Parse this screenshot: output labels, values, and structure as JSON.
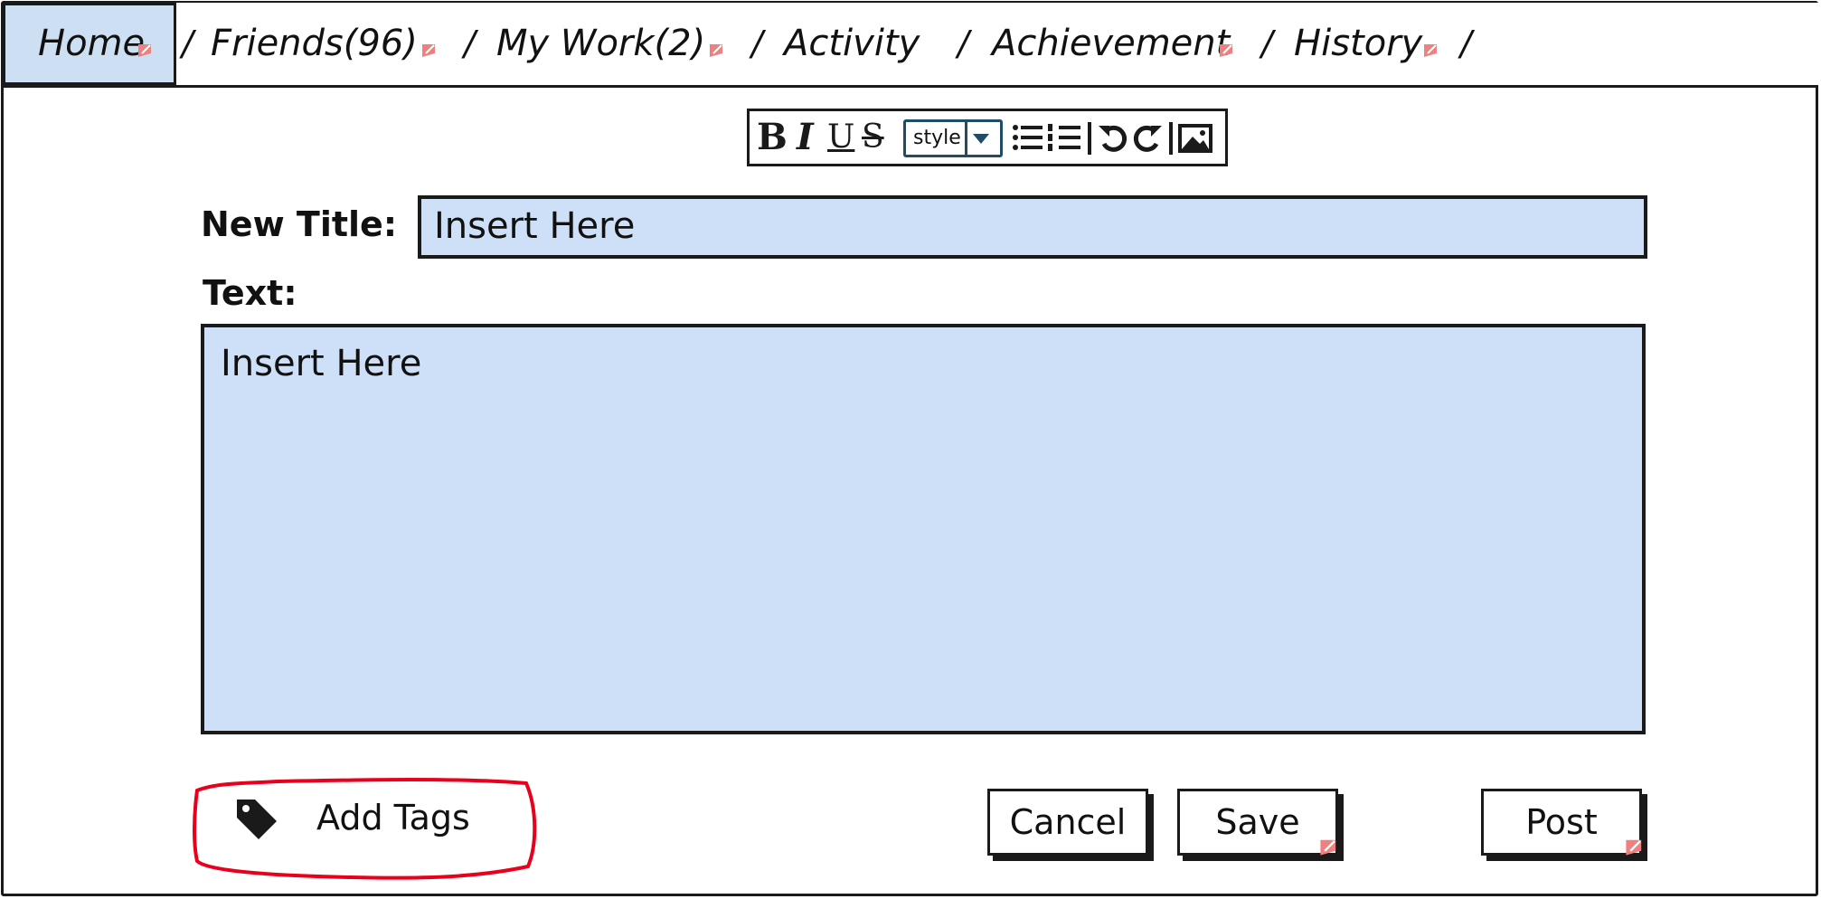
{
  "nav": {
    "items": [
      "Home",
      "Friends(96)",
      "My Work(2)",
      "Activity",
      "Achievement",
      "History"
    ],
    "separator": "/"
  },
  "toolbar": {
    "bold": "B",
    "italic": "I",
    "underline": "U",
    "strike": "S",
    "style_label": "style",
    "icons": [
      "bullet-list-icon",
      "numbered-list-icon",
      "undo-icon",
      "redo-icon",
      "image-icon"
    ]
  },
  "form": {
    "title_label": "New Title:",
    "title_value": "Insert  Here",
    "text_label": "Text:",
    "text_value": "Insert Here"
  },
  "actions": {
    "add_tags": "Add Tags",
    "cancel": "Cancel",
    "save": "Save",
    "post": "Post"
  },
  "colors": {
    "field_bg": "#cde0f7",
    "active_tab_bg": "#cddff2",
    "highlight": "#e8001c",
    "link_icon": "#f08080"
  }
}
